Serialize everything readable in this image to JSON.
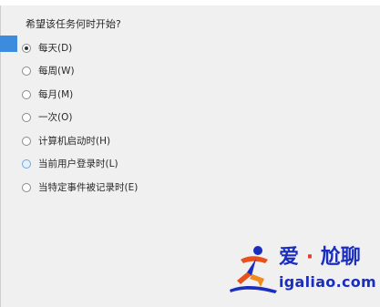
{
  "prompt": "希望该任务何时开始?",
  "options": [
    {
      "label": "每天(D)",
      "checked": true
    },
    {
      "label": "每周(W)",
      "checked": false
    },
    {
      "label": "每月(M)",
      "checked": false
    },
    {
      "label": "一次(O)",
      "checked": false
    },
    {
      "label": "计算机启动时(H)",
      "checked": false
    },
    {
      "label": "当前用户登录时(L)",
      "checked": false
    },
    {
      "label": "当特定事件被记录时(E)",
      "checked": false
    }
  ],
  "watermark": {
    "name_left": "爱",
    "separator": "·",
    "name_right": "尬聊",
    "domain": "igaliao.com"
  }
}
